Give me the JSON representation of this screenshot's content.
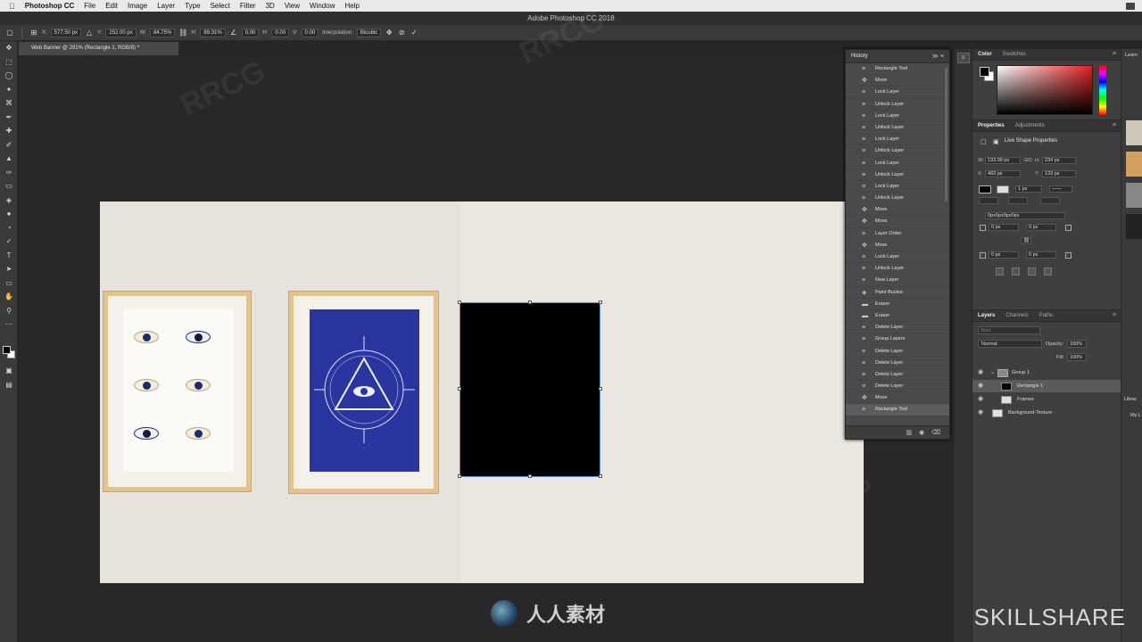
{
  "menubar": {
    "app_name": "Photoshop CC",
    "menus": [
      "File",
      "Edit",
      "Image",
      "Layer",
      "Type",
      "Select",
      "Filter",
      "3D",
      "View",
      "Window",
      "Help"
    ]
  },
  "window_title": "Adobe Photoshop CC 2018",
  "options_bar": {
    "x_label": "X:",
    "x_value": "577.50 px",
    "y_label": "Y:",
    "y_value": "252.00 px",
    "w_label": "W:",
    "w_value": "84.75%",
    "h_label": "H:",
    "h_value": "89.31%",
    "angle_value": "0.00",
    "hskew_label": "H:",
    "hskew_value": "0.00",
    "vskew_label": "V:",
    "vskew_value": "0.00",
    "interp_label": "Interpolation:",
    "interp_value": "Bicubic"
  },
  "document_tab": "Web Banner @ 291% (Rectangle 1, RGB/8) *",
  "history": {
    "title": "History",
    "items": [
      "Rectangle Tool",
      "Move",
      "Lock Layer",
      "Unlock Layer",
      "Lock Layer",
      "Unlock Layer",
      "Lock Layer",
      "Unlock Layer",
      "Lock Layer",
      "Unlock Layer",
      "Lock Layer",
      "Unlock Layer",
      "Move",
      "Move",
      "Layer Order",
      "Move",
      "Lock Layer",
      "Unlock Layer",
      "New Layer",
      "Paint Bucket",
      "Eraser",
      "Eraser",
      "Delete Layer",
      "Group Layers",
      "Delete Layer",
      "Delete Layer",
      "Delete Layer",
      "Delete Layer",
      "Move",
      "Rectangle Tool"
    ],
    "selected_index": 29
  },
  "color_panel": {
    "tabs": [
      "Color",
      "Swatches"
    ],
    "active_tab": "Color",
    "fg_color": "#000000",
    "bg_color": "#ffffff"
  },
  "properties_panel": {
    "tabs": [
      "Properties",
      "Adjustments"
    ],
    "active_tab": "Properties",
    "title": "Live Shape Properties",
    "w_label": "W:",
    "w_value": "133.99 px",
    "go_label": "GO",
    "h_label": "H:",
    "h_value": "234 px",
    "x_label": "X:",
    "x_value": "483 px",
    "y_label": "Y:",
    "y_value": "133 px",
    "stroke_width": "1 px",
    "corner_radius_text": "0px0px0px0px",
    "corners": [
      "0 px",
      "0 px",
      "0 px",
      "0 px"
    ]
  },
  "layers_panel": {
    "tabs": [
      "Layers",
      "Channels",
      "Paths"
    ],
    "active_tab": "Layers",
    "search_placeholder": "Kind",
    "blend_mode": "Normal",
    "opacity_label": "Opacity:",
    "opacity_value": "100%",
    "fill_label": "Fill:",
    "fill_value": "100%",
    "layers": [
      {
        "name": "Group 1",
        "selected": false
      },
      {
        "name": "Rectangle 1",
        "selected": true
      },
      {
        "name": "Frames",
        "selected": false
      },
      {
        "name": "Background-Texture",
        "selected": false
      }
    ]
  },
  "right_strip": {
    "learn_label": "Learn",
    "libraries_label": "Librar",
    "libraries_sub": "My L"
  },
  "watermarks": {
    "skillshare": "SKILLSHARE",
    "cn": "人人素材",
    "rrcg": "RRCG"
  }
}
